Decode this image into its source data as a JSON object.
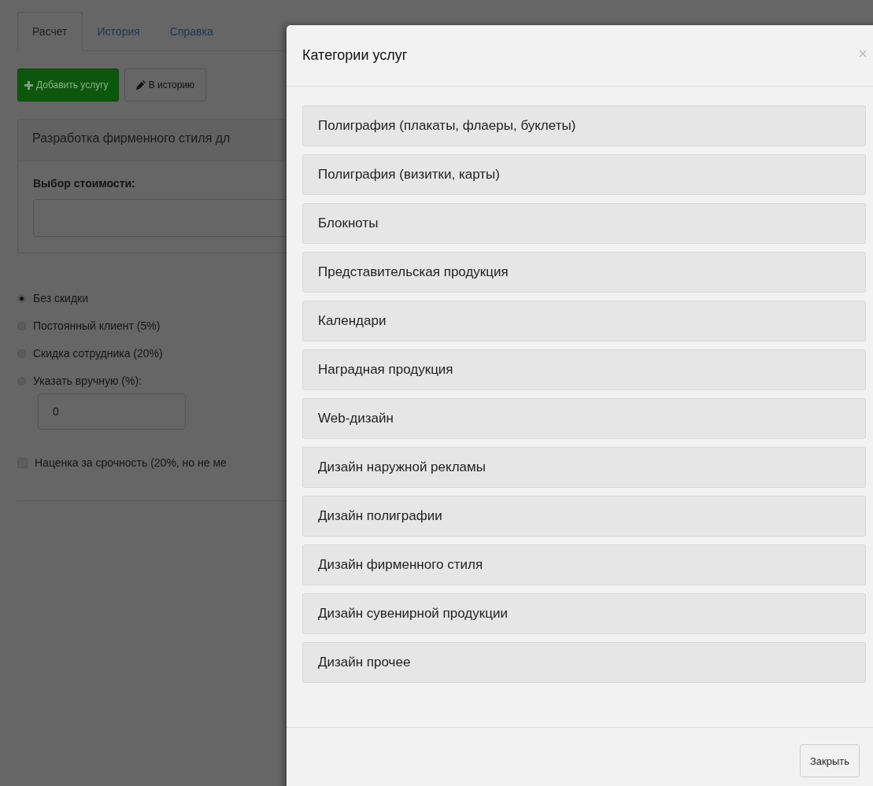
{
  "tabs": [
    {
      "label": "Расчет",
      "selected": true
    },
    {
      "label": "История",
      "selected": false
    },
    {
      "label": "Справка",
      "selected": false
    }
  ],
  "toolbar": {
    "buttons": [
      {
        "label": "Добавить услугу",
        "kind": "add"
      },
      {
        "label": "В историю",
        "kind": "edit"
      }
    ]
  },
  "service_panel": {
    "title": "Разработка фирменного стиля дл",
    "field_label": "Выбор стоимости:"
  },
  "discounts": [
    {
      "label": "Без скидки",
      "selected": true
    },
    {
      "label": "Постоянный клиент (5%)",
      "selected": false
    },
    {
      "label": "Скидка сотрудника (20%)",
      "selected": false
    },
    {
      "label": "Указать вручную (%):",
      "selected": false
    }
  ],
  "manual_discount": {
    "value": "0"
  },
  "urgency": {
    "label": "Наценка за срочность (20%, но не ме",
    "checked": false
  },
  "modal": {
    "title": "Категории услуг",
    "close_icon": "×",
    "categories": [
      "Полиграфия (плакаты, флаеры, буклеты)",
      "Полиграфия (визитки, карты)",
      "Блокноты",
      "Представительская продукция",
      "Календари",
      "Наградная продукция",
      "Web-дизайн",
      "Дизайн наружной рекламы",
      "Дизайн полиграфии",
      "Дизайн фирменного стиля",
      "Дизайн сувенирной продукции",
      "Дизайн прочее"
    ],
    "footer_button": "Закрыть"
  }
}
